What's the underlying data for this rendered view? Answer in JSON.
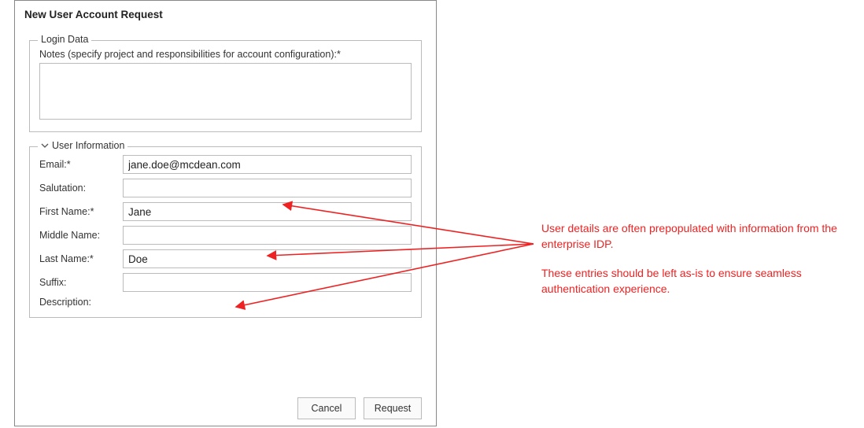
{
  "dialog": {
    "title": "New User Account Request",
    "login_data": {
      "legend": "Login Data",
      "notes_label": "Notes (specify project and responsibilities for account configuration):*",
      "notes_value": ""
    },
    "user_info": {
      "legend": "User Information",
      "fields": {
        "email": {
          "label": "Email:*",
          "value": "jane.doe@mcdean.com"
        },
        "salutation": {
          "label": "Salutation:",
          "value": ""
        },
        "first_name": {
          "label": "First Name:*",
          "value": "Jane"
        },
        "middle_name": {
          "label": "Middle Name:",
          "value": ""
        },
        "last_name": {
          "label": "Last Name:*",
          "value": "Doe"
        },
        "suffix": {
          "label": "Suffix:",
          "value": ""
        }
      },
      "description_label": "Description:"
    },
    "buttons": {
      "cancel": "Cancel",
      "request": "Request"
    }
  },
  "annotation": {
    "para1": "User details are often prepopulated with information from the enterprise IDP.",
    "para2": "These entries should be left as-is to ensure seamless authentication experience."
  },
  "colors": {
    "annotation": "#ee2222",
    "border": "#bbbbbb"
  }
}
